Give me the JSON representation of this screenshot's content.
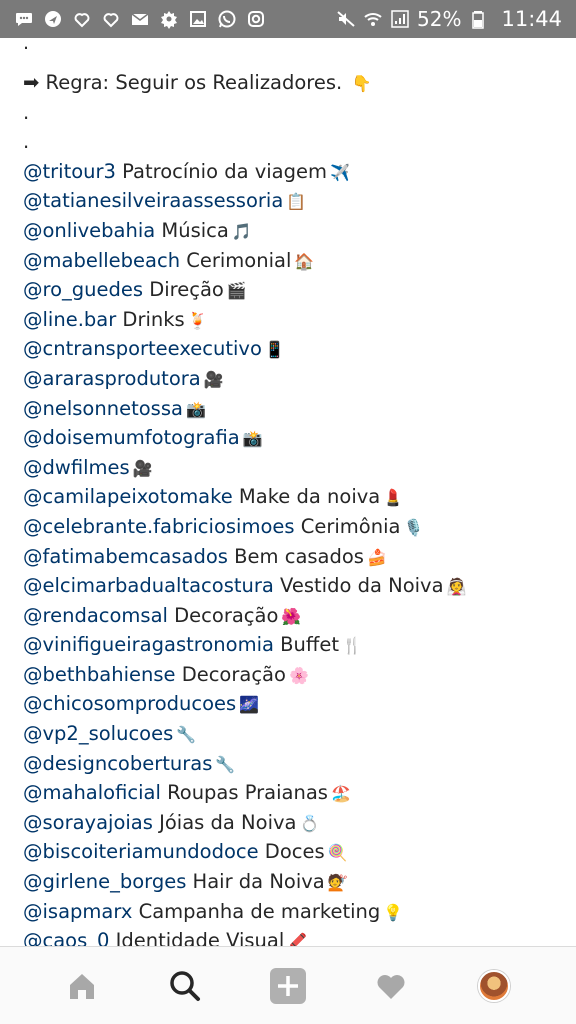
{
  "status_bar": {
    "battery_percent": "52%",
    "time": "11:44",
    "left_icons": [
      "chat-icon",
      "navigation-icon",
      "heart-icon",
      "heart-icon",
      "mail-icon",
      "gear-icon",
      "image-icon",
      "whatsapp-icon",
      "instagram-icon"
    ],
    "right_icons": [
      "mute-icon",
      "wifi-icon",
      "signal-icon",
      "battery-icon"
    ]
  },
  "post": {
    "top_dot": ".",
    "rule_line": {
      "prefix": "➡",
      "text": "Regra: Seguir os Realizadores.",
      "emoji": "👇"
    },
    "spacer_dots": [
      ".",
      "."
    ],
    "credits": [
      {
        "handle": "@tritour3",
        "text": " Patrocínio da viagem",
        "emoji": "✈️"
      },
      {
        "handle": "@tatianesilveiraassessoria",
        "text": "",
        "emoji": "📋"
      },
      {
        "handle": "@onlivebahia",
        "text": " Música",
        "emoji": "🎵"
      },
      {
        "handle": "@mabellebeach",
        "text": " Cerimonial",
        "emoji": "🏠"
      },
      {
        "handle": "@ro_guedes",
        "text": " Direção",
        "emoji": "🎬"
      },
      {
        "handle": "@line.bar",
        "text": " Drinks",
        "emoji": "🍹"
      },
      {
        "handle": "@cntransporteexecutivo",
        "text": "",
        "emoji": "📱"
      },
      {
        "handle": "@ararasprodutora",
        "text": "",
        "emoji": "🎥"
      },
      {
        "handle": "@nelsonnetossa",
        "text": "",
        "emoji": "📸"
      },
      {
        "handle": "@doisemumfotografia",
        "text": "",
        "emoji": "📸"
      },
      {
        "handle": "@dwfilmes",
        "text": "",
        "emoji": "🎥"
      },
      {
        "handle": "@camilapeixotomake",
        "text": " Make da noiva",
        "emoji": "💄"
      },
      {
        "handle": "@celebrante.fabriciosimoes",
        "text": " Cerimônia",
        "emoji": "🎙️"
      },
      {
        "handle": "@fatimabemcasados",
        "text": " Bem casados",
        "emoji": "🍰"
      },
      {
        "handle": "@elcimarbadualtacostura",
        "text": " Vestido da Noiva",
        "emoji": "👰"
      },
      {
        "handle": "@rendacomsal",
        "text": " Decoração",
        "emoji": "🌺"
      },
      {
        "handle": "@vinifigueiragastronomia",
        "text": " Buffet",
        "emoji": "🍴"
      },
      {
        "handle": "@bethbahiense",
        "text": " Decoração",
        "emoji": "🌸"
      },
      {
        "handle": "@chicosomproducoes",
        "text": "",
        "emoji": "🌌"
      },
      {
        "handle": "@vp2_solucoes",
        "text": "",
        "emoji": "🔧"
      },
      {
        "handle": "@designcoberturas",
        "text": "",
        "emoji": "🔧"
      },
      {
        "handle": "@mahaloficial",
        "text": " Roupas Praianas",
        "emoji": "🏖️"
      },
      {
        "handle": "@sorayajoias",
        "text": " Jóias da Noiva",
        "emoji": "💍"
      },
      {
        "handle": "@biscoiteriamundodoce",
        "text": " Doces",
        "emoji": "🍭"
      },
      {
        "handle": "@girlene_borges",
        "text": " Hair da Noiva",
        "emoji": "💇"
      },
      {
        "handle": "@isapmarx",
        "text": " Campanha de marketing",
        "emoji": "💡"
      },
      {
        "handle": "@caos_0",
        "text": " Identidade Visual",
        "emoji": "🖍️"
      }
    ]
  },
  "bottom_nav": {
    "items": [
      "home-icon",
      "search-icon",
      "add-icon",
      "activity-heart-icon",
      "profile-avatar"
    ],
    "active": "search-icon"
  }
}
